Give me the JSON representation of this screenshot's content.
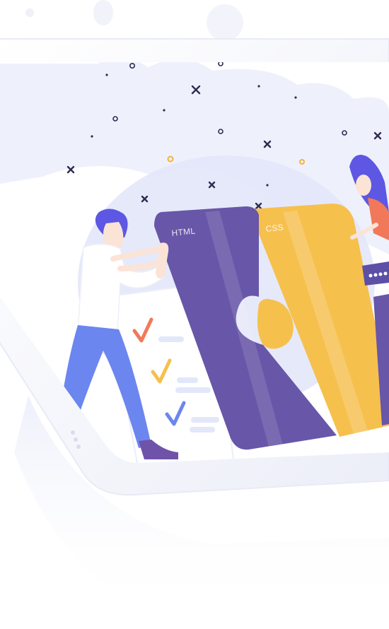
{
  "illustration": {
    "cards": {
      "html_label": "HTML",
      "css_label": "CSS"
    },
    "colors": {
      "background": "#ffffff",
      "tablet_frame": "#f4f5fb",
      "screen_bg": "#eef1fc",
      "html_card": "#6856a8",
      "css_card": "#f6c04d",
      "person_hair": "#5d57e3",
      "person_pants": "#6c86ef",
      "person_shoes": "#6f53a8",
      "check_orange": "#f1795a",
      "check_yellow": "#f6c04d",
      "check_blue": "#6c86ef",
      "sparkle_dark": "#2f2a52",
      "sparkle_orange": "#f6b23a"
    },
    "icons": [
      "checkmark-icon",
      "checkmark-icon",
      "checkmark-icon",
      "sparkle-icon"
    ]
  }
}
